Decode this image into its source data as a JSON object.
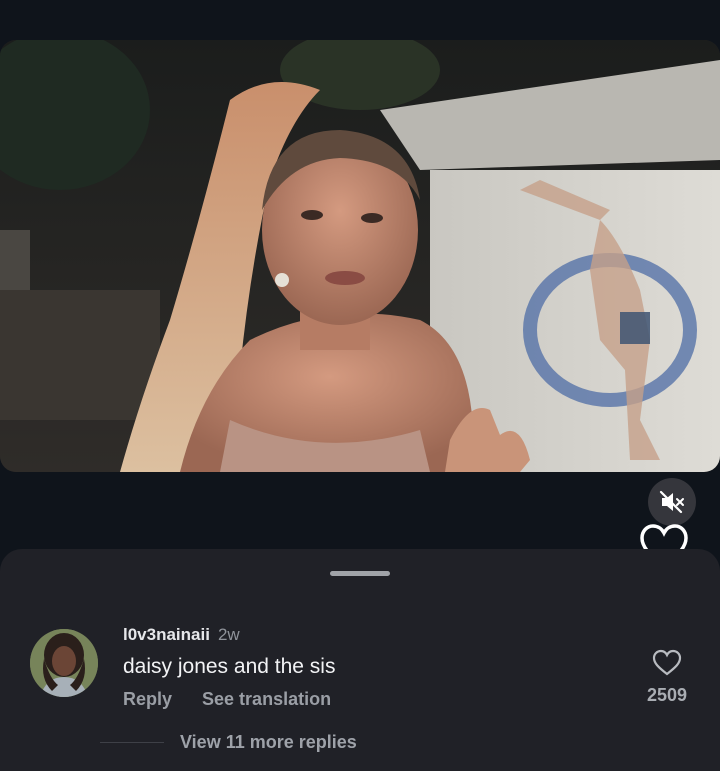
{
  "video": {
    "muted": true,
    "icons": {
      "mute": "volume-muted-icon",
      "like": "heart-outline-icon"
    }
  },
  "comment": {
    "username": "l0v3nainaii",
    "time": "2w",
    "text": "daisy jones and the sis",
    "reply_label": "Reply",
    "translate_label": "See translation",
    "like_count": "2509",
    "like_icon": "heart-outline-icon"
  },
  "replies": {
    "label": "View 11 more replies"
  }
}
